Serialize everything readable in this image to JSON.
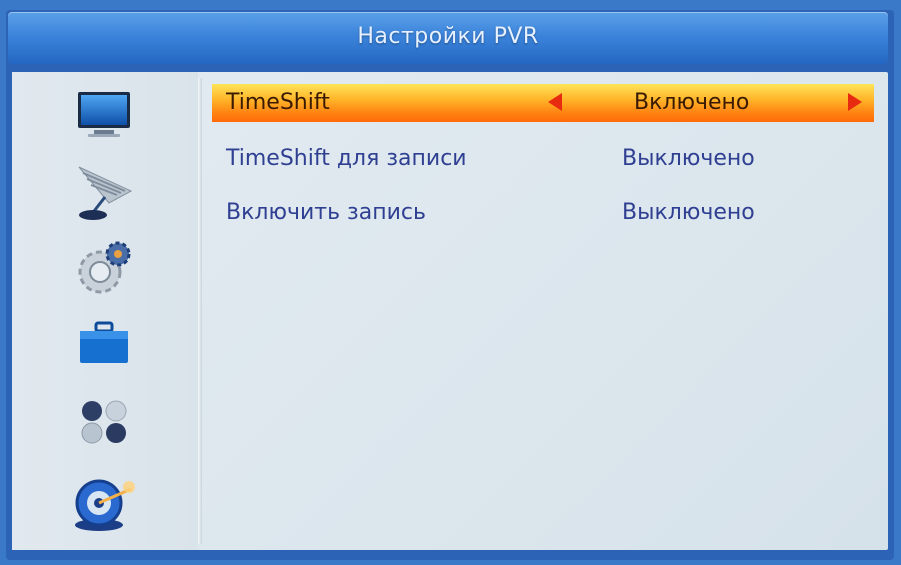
{
  "header": {
    "title": "Настройки PVR"
  },
  "sidebar": {
    "icons": [
      "tv-icon",
      "satellite-dish-icon",
      "gear-icon",
      "briefcase-icon",
      "circles-icon",
      "media-disc-icon"
    ]
  },
  "menu": {
    "rows": [
      {
        "label": "TimeShift",
        "value": "Включено",
        "selected": true
      },
      {
        "label": "TimeShift для записи",
        "value": "Выключено",
        "selected": false
      },
      {
        "label": "Включить запись",
        "value": "Выключено",
        "selected": false
      }
    ]
  },
  "colors": {
    "title_bar": "#3c84db",
    "highlight": "#ff8412",
    "text": "#2f3f92",
    "arrow": "#e82a10"
  }
}
